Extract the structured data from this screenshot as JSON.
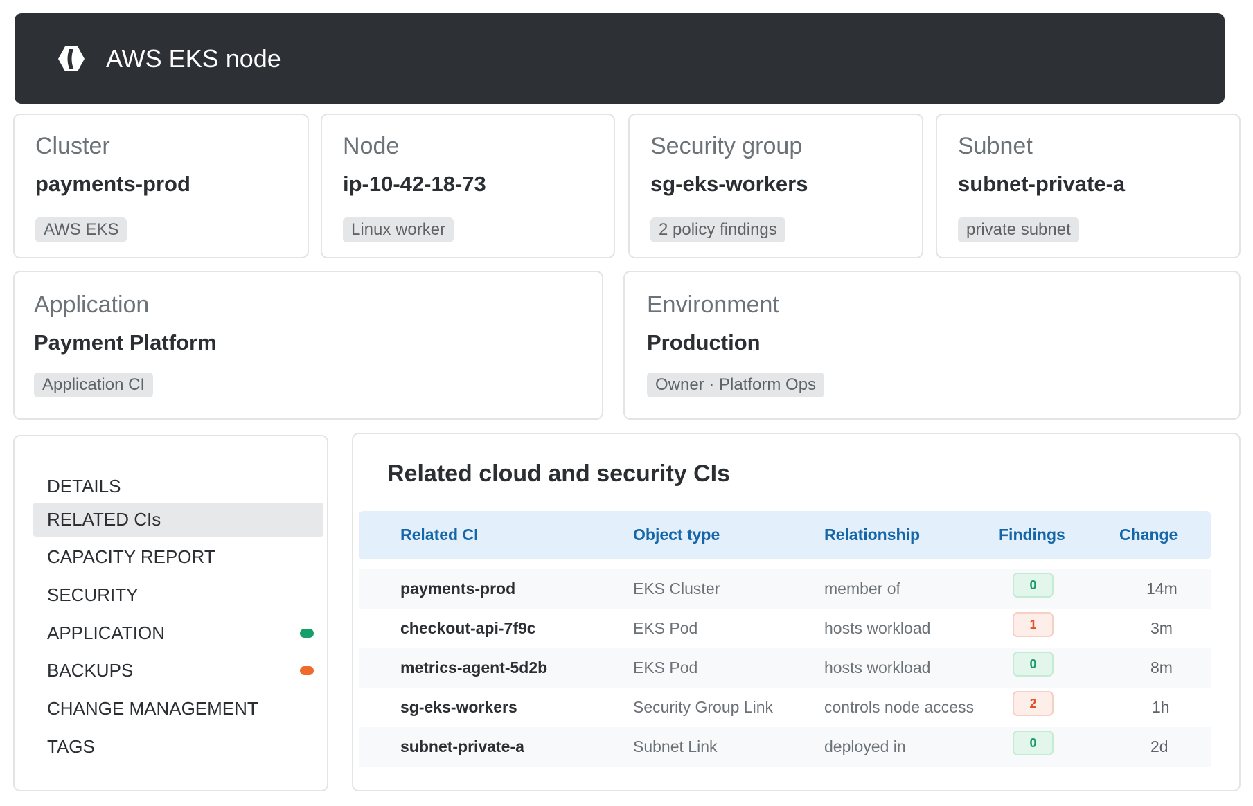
{
  "header": {
    "title": "AWS EKS node",
    "logo_icon": "eks-logo-icon"
  },
  "cards": [
    {
      "label": "Cluster",
      "value": "payments-prod",
      "chip": "AWS EKS"
    },
    {
      "label": "Node",
      "value": "ip-10-42-18-73",
      "chip": "Linux worker"
    },
    {
      "label": "Security group",
      "value": "sg-eks-workers",
      "chip": "2 policy findings"
    },
    {
      "label": "Subnet",
      "value": "subnet-private-a",
      "chip": "private subnet"
    },
    {
      "label": "Application",
      "value": "Payment Platform",
      "chip": "Application CI"
    },
    {
      "label": "Environment",
      "value": "Production",
      "chip": "Owner · Platform Ops"
    }
  ],
  "sidenav": {
    "items": [
      {
        "label": "DETAILS"
      },
      {
        "label": "RELATED CIs",
        "active": true
      },
      {
        "label": "CAPACITY REPORT"
      },
      {
        "label": "SECURITY"
      },
      {
        "label": "APPLICATION",
        "dot_color": "#14a06a"
      },
      {
        "label": "BACKUPS",
        "dot_color": "#f06a2e"
      },
      {
        "label": "CHANGE MANAGEMENT"
      },
      {
        "label": "TAGS"
      }
    ]
  },
  "related": {
    "title": "Related cloud and security CIs",
    "columns": [
      "Related CI",
      "Object type",
      "Relationship",
      "Findings",
      "Change"
    ],
    "rows": [
      {
        "ci": "payments-prod",
        "type": "EKS Cluster",
        "relationship": "member of",
        "findings": "0",
        "change": "14m"
      },
      {
        "ci": "checkout-api-7f9c",
        "type": "EKS Pod",
        "relationship": "hosts workload",
        "findings": "1",
        "change": "3m"
      },
      {
        "ci": "metrics-agent-5d2b",
        "type": "EKS Pod",
        "relationship": "hosts workload",
        "findings": "0",
        "change": "8m"
      },
      {
        "ci": "sg-eks-workers",
        "type": "Security Group Link",
        "relationship": "controls node access",
        "findings": "2",
        "change": "1h"
      },
      {
        "ci": "subnet-private-a",
        "type": "Subnet Link",
        "relationship": "deployed in",
        "findings": "0",
        "change": "2d"
      }
    ]
  },
  "colors": {
    "header_bg": "#2d3135",
    "accent_blue": "#1466a8",
    "table_header_bg": "#e3f0fb",
    "findings_ok_bg": "#e3f6ec",
    "findings_ok_fg": "#1a9a62",
    "findings_warn_bg": "#fdeeea",
    "findings_warn_fg": "#e0522a"
  }
}
